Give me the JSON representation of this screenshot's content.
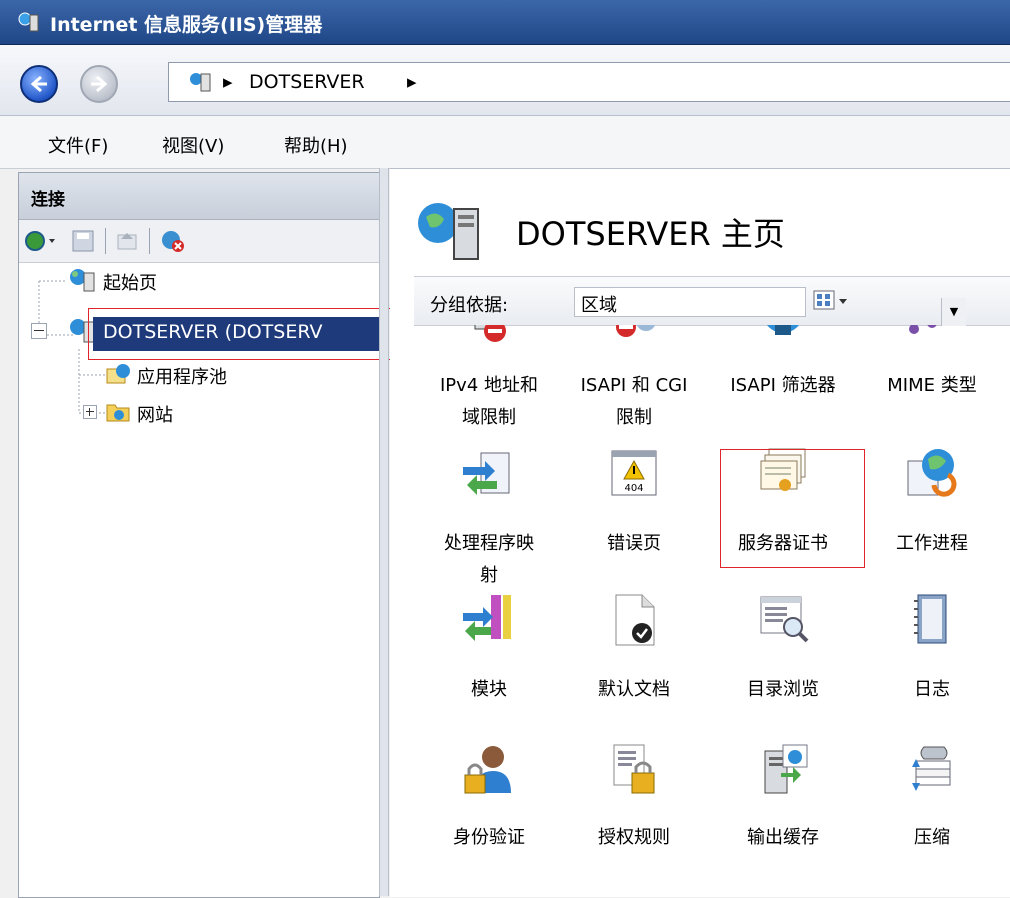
{
  "window": {
    "title": "Internet 信息服务(IIS)管理器"
  },
  "address": {
    "crumbs": [
      "DOTSERVER"
    ]
  },
  "menu": {
    "items": [
      "文件(F)",
      "视图(V)",
      "帮助(H)"
    ]
  },
  "connections": {
    "title": "连接",
    "tree": [
      {
        "label": "起始页"
      },
      {
        "label": "DOTSERVER (DOTSERV"
      },
      {
        "label": "应用程序池"
      },
      {
        "label": "网站"
      }
    ]
  },
  "main": {
    "title": "DOTSERVER 主页",
    "group_label": "分组依据:",
    "group_value": "区域",
    "features": [
      {
        "name": "IPv4 地址和域限制",
        "lines": [
          "IPv4 地址和",
          "域限制"
        ],
        "icon": "ipv4-restriction-icon"
      },
      {
        "name": "ISAPI 和 CGI 限制",
        "lines": [
          "ISAPI 和 CGI",
          "限制"
        ],
        "icon": "isapi-cgi-icon"
      },
      {
        "name": "ISAPI 筛选器",
        "lines": [
          "ISAPI 筛选器"
        ],
        "icon": "isapi-filter-icon"
      },
      {
        "name": "MIME 类型",
        "lines": [
          "MIME 类型"
        ],
        "icon": "mime-types-icon"
      },
      {
        "name": "处理程序映射",
        "lines": [
          "处理程序映",
          "射"
        ],
        "icon": "handler-mappings-icon"
      },
      {
        "name": "错误页",
        "lines": [
          "错误页"
        ],
        "icon": "error-pages-icon"
      },
      {
        "name": "服务器证书",
        "lines": [
          "服务器证书"
        ],
        "icon": "server-certificates-icon"
      },
      {
        "name": "工作进程",
        "lines": [
          "工作进程"
        ],
        "icon": "worker-processes-icon"
      },
      {
        "name": "模块",
        "lines": [
          "模块"
        ],
        "icon": "modules-icon"
      },
      {
        "name": "默认文档",
        "lines": [
          "默认文档"
        ],
        "icon": "default-document-icon"
      },
      {
        "name": "目录浏览",
        "lines": [
          "目录浏览"
        ],
        "icon": "directory-browsing-icon"
      },
      {
        "name": "日志",
        "lines": [
          "日志"
        ],
        "icon": "logging-icon"
      },
      {
        "name": "身份验证",
        "lines": [
          "身份验证"
        ],
        "icon": "authentication-icon"
      },
      {
        "name": "授权规则",
        "lines": [
          "授权规则"
        ],
        "icon": "authorization-rules-icon"
      },
      {
        "name": "输出缓存",
        "lines": [
          "输出缓存"
        ],
        "icon": "output-caching-icon"
      },
      {
        "name": "压缩",
        "lines": [
          "压缩"
        ],
        "icon": "compression-icon"
      }
    ],
    "error_icon_text": "404"
  },
  "colors": {
    "title_bar": "#1f4788",
    "selection": "#1e3a7a",
    "highlight_box": "#e0242c"
  }
}
